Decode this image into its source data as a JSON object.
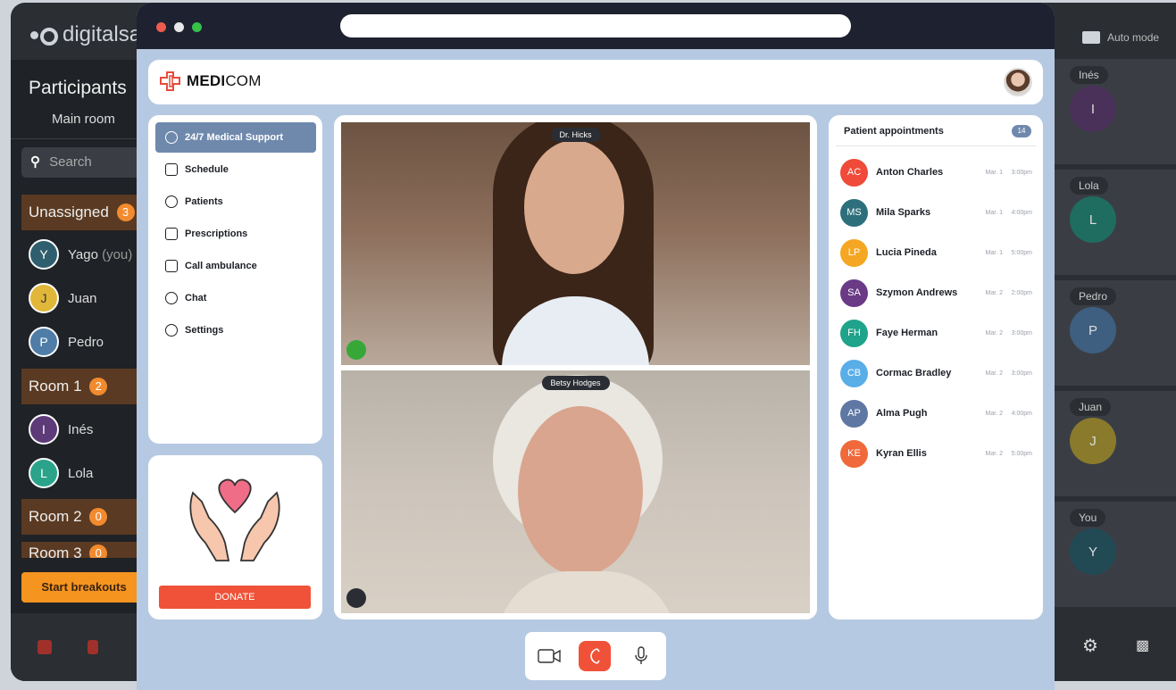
{
  "background_left": {
    "logo_text": "digitalsa",
    "title": "Participants",
    "main_room": "Main room",
    "search_placeholder": "Search",
    "groups": [
      {
        "label": "Unassigned",
        "count": "3"
      },
      {
        "label": "Room 1",
        "count": "2"
      },
      {
        "label": "Room 2",
        "count": "0"
      },
      {
        "label": "Room 3",
        "count": "0"
      }
    ],
    "members": [
      {
        "initial": "Y",
        "name": "Yago",
        "suffix": "(you)",
        "color": "#2f5f6e"
      },
      {
        "initial": "J",
        "name": "Juan",
        "color": "#e1b73a"
      },
      {
        "initial": "P",
        "name": "Pedro",
        "color": "#4f7da7"
      },
      {
        "initial": "I",
        "name": "Inés",
        "color": "#5d3a78"
      },
      {
        "initial": "L",
        "name": "Lola",
        "color": "#2aa38a"
      }
    ],
    "start_button": "Start breakouts"
  },
  "background_right": {
    "mode_label": "Auto mode",
    "tiles": [
      {
        "name": "Inés",
        "initial": "I",
        "color": "#4a3159"
      },
      {
        "name": "Lola",
        "initial": "L",
        "color": "#1f6d60"
      },
      {
        "name": "Pedro",
        "initial": "P",
        "color": "#3e5f80"
      },
      {
        "name": "Juan",
        "initial": "J",
        "color": "#8a7a2c"
      },
      {
        "name": "You",
        "initial": "Y",
        "color": "#214a55"
      }
    ]
  },
  "app": {
    "brand_bold": "MEDI",
    "brand_rest": "COM",
    "brand_color": "#e94b3c",
    "accent": "#6f89ad",
    "nav": [
      {
        "label": "24/7 Medical Support",
        "icon": "support-icon",
        "active": true
      },
      {
        "label": "Schedule",
        "icon": "calendar-icon"
      },
      {
        "label": "Patients",
        "icon": "patients-icon"
      },
      {
        "label": "Prescriptions",
        "icon": "prescription-icon"
      },
      {
        "label": "Call ambulance",
        "icon": "ambulance-icon"
      },
      {
        "label": "Chat",
        "icon": "chat-icon"
      },
      {
        "label": "Settings",
        "icon": "settings-icon"
      }
    ],
    "donate_label": "DONATE",
    "video": {
      "top_name": "Dr. Hicks",
      "bottom_name": "Betsy Hodges"
    },
    "appointments": {
      "title": "Patient appointments",
      "count": "14",
      "items": [
        {
          "initials": "AC",
          "name": "Anton Charles",
          "date": "Mar. 1",
          "time": "3:00pm",
          "color": "#ef4a3a"
        },
        {
          "initials": "MS",
          "name": "Mila Sparks",
          "date": "Mar. 1",
          "time": "4:00pm",
          "color": "#2e6f7c"
        },
        {
          "initials": "LP",
          "name": "Lucia Pineda",
          "date": "Mar. 1",
          "time": "5:00pm",
          "color": "#f5a623"
        },
        {
          "initials": "SA",
          "name": "Szymon Andrews",
          "date": "Mar. 2",
          "time": "2:00pm",
          "color": "#6a3a86"
        },
        {
          "initials": "FH",
          "name": "Faye Herman",
          "date": "Mar. 2",
          "time": "3:00pm",
          "color": "#1fa38a"
        },
        {
          "initials": "CB",
          "name": "Cormac Bradley",
          "date": "Mar. 2",
          "time": "3:00pm",
          "color": "#5aaee8"
        },
        {
          "initials": "AP",
          "name": "Alma Pugh",
          "date": "Mar. 2",
          "time": "4:00pm",
          "color": "#5f78a3"
        },
        {
          "initials": "KE",
          "name": "Kyran Ellis",
          "date": "Mar. 2",
          "time": "5:00pm",
          "color": "#f0693a"
        }
      ]
    }
  }
}
